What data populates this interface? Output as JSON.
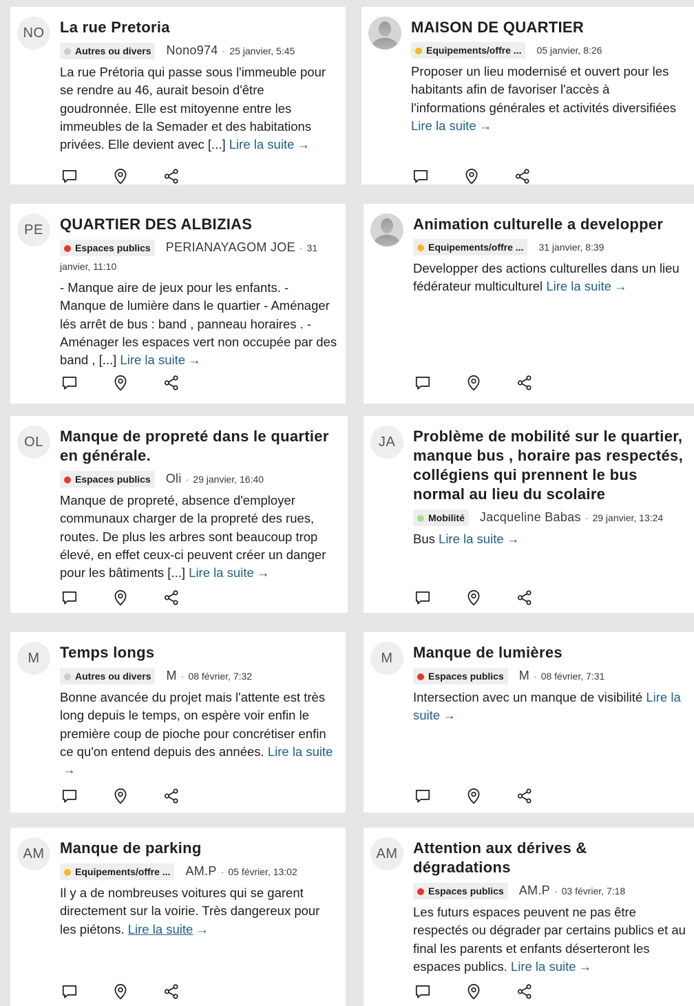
{
  "colors": {
    "gris": "#cccccc",
    "rouge": "#e8362d",
    "jaune": "#f6b820",
    "vert": "#a8e08a",
    "link": "#1f5f8a"
  },
  "icons": {
    "comment": "comment-icon",
    "location": "location-pin-icon",
    "share": "share-icon",
    "anonymous_avatar": "user-silhouette-icon"
  },
  "cards": [
    {
      "avatar": "NO",
      "title": "La rue Pretoria",
      "category": "Autres ou divers",
      "category_color": "gris",
      "author": "Nono974",
      "date": "25 janvier, 5:45",
      "description": "La rue Prétoria qui passe sous l'immeuble pour se rendre au 46, aurait besoin d'être goudronnée. Elle est mitoyenne entre les immeubles de la Semader et des habitations privées. Elle devient avec [...]",
      "read_more": "Lire la suite",
      "arrow": "→"
    },
    {
      "avatar": "",
      "title": "MAISON DE QUARTIER",
      "category": "Equipements/offre ...",
      "category_color": "jaune",
      "author": "",
      "date": "05 janvier, 8:26",
      "description": "Proposer un lieu modernisé et ouvert pour les habitants afin de favoriser l'accès à l'informations générales et activités diversifiées",
      "read_more": "Lire la suite",
      "arrow": "→"
    },
    {
      "avatar": "PE",
      "title": "QUARTIER DES ALBIZIAS",
      "category": "Espaces publics",
      "category_color": "rouge",
      "author": "PERIANAYAGOM JOE",
      "date": "31 janvier, 11:10",
      "description": "- Manque aire de jeux pour les enfants. - Manque de lumière dans le quartier - Aménager lés arrêt de bus : band , panneau horaires . - Aménager les espaces vert non occupée par des band , [...]",
      "read_more": "Lire la suite",
      "arrow": "→"
    },
    {
      "avatar": "",
      "title": "Animation culturelle a developper",
      "category": "Equipements/offre ...",
      "category_color": "jaune",
      "author": "",
      "date": "31 janvier, 8:39",
      "description": "Developper des actions culturelles dans un lieu fédérateur multiculturel",
      "read_more": "Lire la suite",
      "arrow": "→"
    },
    {
      "avatar": "OL",
      "title": "Manque de propreté dans le quartier en générale.",
      "category": "Espaces publics",
      "category_color": "rouge",
      "author": "Oli",
      "date": "29 janvier, 16:40",
      "description": "Manque de propreté, absence d'employer communaux charger de la propreté des rues, routes. De plus les arbres sont beaucoup trop élevé, en effet ceux-ci peuvent créer un danger pour les bâtiments [...]",
      "read_more": "Lire la suite",
      "arrow": "→"
    },
    {
      "avatar": "JA",
      "title": "Problème de mobilité sur le quartier, manque bus , horaire pas respectés, collégiens qui prennent le bus normal au lieu du scolaire",
      "category": "Mobilité",
      "category_color": "vert",
      "author": "Jacqueline Babas",
      "date": "29 janvier, 13:24",
      "description": "Bus",
      "read_more": "Lire la suite",
      "arrow": "→"
    },
    {
      "avatar": "M",
      "title": "Temps longs",
      "category": "Autres ou divers",
      "category_color": "gris",
      "author": "M",
      "date": "08 février, 7:32",
      "description": "Bonne avancée du projet mais l'attente est très long depuis le temps, on espère voir enfin le première coup de pioche pour concrétiser enfin ce qu'on entend depuis des années.",
      "read_more": "Lire la suite",
      "arrow": "→"
    },
    {
      "avatar": "M",
      "title": "Manque de lumières",
      "category": "Espaces publics",
      "category_color": "rouge",
      "author": "M",
      "date": "08 février, 7:31",
      "description": "Intersection avec un manque de visibilité",
      "read_more": "Lire la suite",
      "arrow": "→"
    },
    {
      "avatar": "AM",
      "title": "Manque de parking",
      "category": "Equipements/offre ...",
      "category_color": "jaune",
      "author": "AM.P",
      "date": "05 février, 13:02",
      "description": "Il y a de nombreuses voitures qui se garent directement sur la voirie. Très dangereux pour les piétons.",
      "read_more": "Lire la suite",
      "arrow": "→"
    },
    {
      "avatar": "AM",
      "title": "Attention aux dérives & dégradations",
      "category": "Espaces publics",
      "category_color": "rouge",
      "author": "AM.P",
      "date": "03 février, 7:18",
      "description": "Les futurs espaces peuvent ne pas être respectés ou dégrader par certains publics et au final les parents et enfants déserteront les espaces publics.",
      "read_more": "Lire la suite",
      "arrow": "→"
    }
  ]
}
